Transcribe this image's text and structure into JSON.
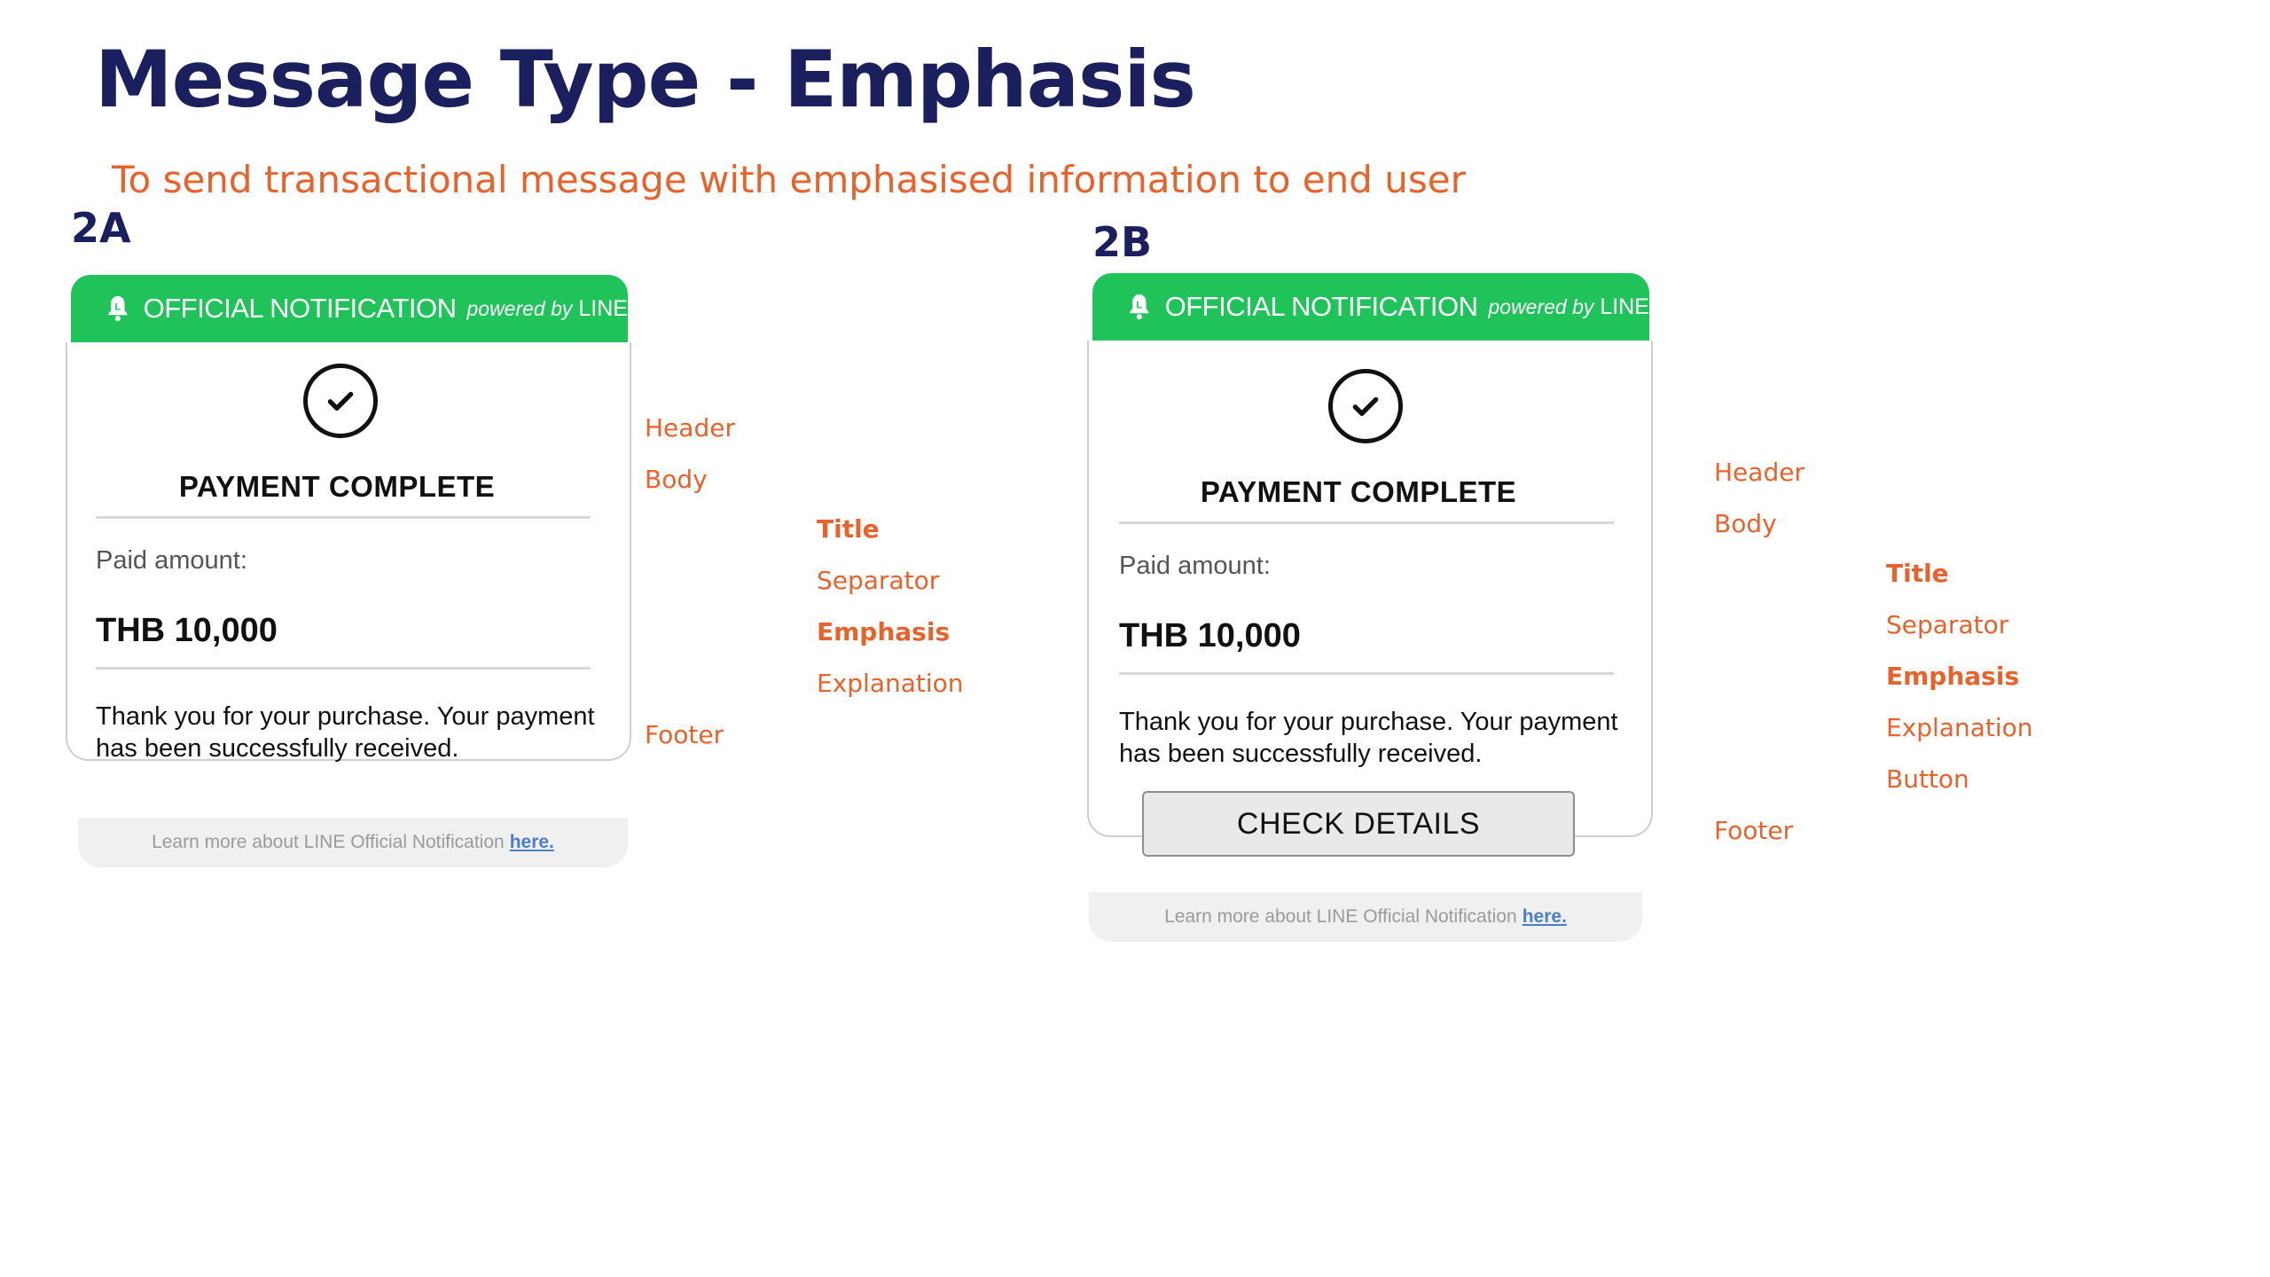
{
  "page": {
    "title": "Message Type - Emphasis",
    "subtitle": "To send transactional message with emphasised information to end user"
  },
  "colors": {
    "title": "#1b1f5e",
    "accent": "#e8622c",
    "line_green": "#1fc35a",
    "link": "#4a7fc8"
  },
  "variant_a": {
    "label": "2A",
    "header": {
      "official": "OFFICIAL NOTIFICATION",
      "powered_by": "powered by",
      "brand": "LINE",
      "icon": "bell-icon"
    },
    "icon": "check-circle-icon",
    "title": "PAYMENT COMPLETE",
    "paid_label": "Paid amount:",
    "amount": "THB 10,000",
    "explanation": "Thank you for your purchase. Your payment has been successfully received.",
    "footer_text": "Learn more about LINE Official Notification",
    "footer_link": "here.",
    "annotations": {
      "header": "Header",
      "body": "Body",
      "title": "Title",
      "separator": "Separator",
      "emphasis": "Emphasis",
      "explanation": "Explanation",
      "footer": "Footer"
    }
  },
  "variant_b": {
    "label": "2B",
    "header": {
      "official": "OFFICIAL NOTIFICATION",
      "powered_by": "powered by",
      "brand": "LINE",
      "icon": "bell-icon"
    },
    "icon": "check-circle-icon",
    "title": "PAYMENT COMPLETE",
    "paid_label": "Paid amount:",
    "amount": "THB 10,000",
    "explanation": "Thank you for your purchase. Your payment has been successfully received.",
    "button_label": "CHECK DETAILS",
    "footer_text": "Learn more about LINE Official Notification",
    "footer_link": "here.",
    "annotations": {
      "header": "Header",
      "body": "Body",
      "title": "Title",
      "separator": "Separator",
      "emphasis": "Emphasis",
      "explanation": "Explanation",
      "button": "Button",
      "footer": "Footer"
    }
  }
}
